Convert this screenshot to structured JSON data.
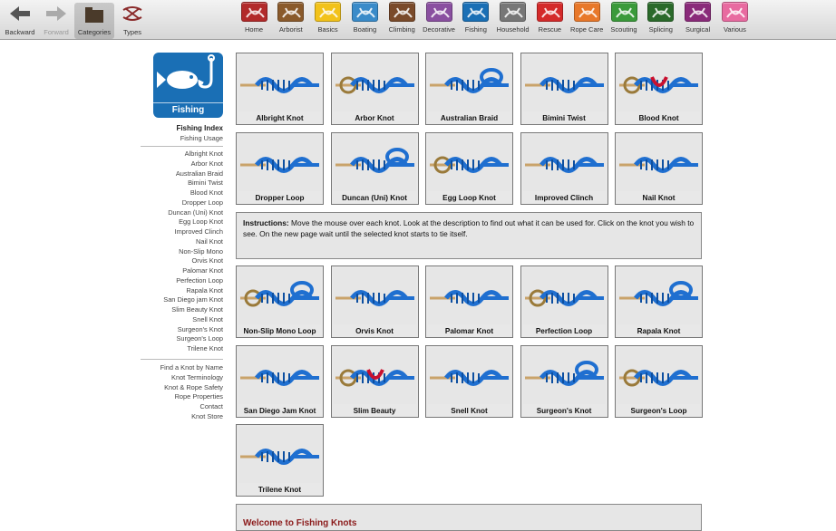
{
  "toolbar": {
    "nav": [
      {
        "label": "Backward",
        "icon": "back-arrow-icon",
        "enabled": true
      },
      {
        "label": "Forward",
        "icon": "forward-arrow-icon",
        "enabled": false
      },
      {
        "label": "Categories",
        "icon": "categories-icon",
        "active": true
      },
      {
        "label": "Types",
        "icon": "types-icon"
      }
    ],
    "categories": [
      {
        "label": "Home",
        "color": "#b22a2a",
        "icon": "knot-home-icon"
      },
      {
        "label": "Arborist",
        "color": "#8a5a2b",
        "icon": "tree-icon"
      },
      {
        "label": "Basics",
        "color": "#f2c21a",
        "icon": "cube-icon"
      },
      {
        "label": "Boating",
        "color": "#3a8bc9",
        "icon": "sailboat-icon"
      },
      {
        "label": "Climbing",
        "color": "#7a4a2a",
        "icon": "climber-icon"
      },
      {
        "label": "Decorative",
        "color": "#8a4fa0",
        "icon": "decorative-knot-icon"
      },
      {
        "label": "Fishing",
        "color": "#1a6fb5",
        "icon": "fish-icon"
      },
      {
        "label": "Household",
        "color": "#777777",
        "icon": "house-icon"
      },
      {
        "label": "Rescue",
        "color": "#d42a2a",
        "icon": "helicopter-icon"
      },
      {
        "label": "Rope Care",
        "color": "#e8782a",
        "icon": "rope-coil-icon"
      },
      {
        "label": "Scouting",
        "color": "#3a9a3a",
        "icon": "tent-icon"
      },
      {
        "label": "Splicing",
        "color": "#2a6a2a",
        "icon": "splice-icon"
      },
      {
        "label": "Surgical",
        "color": "#8a2a7a",
        "icon": "medical-bag-icon"
      },
      {
        "label": "Various",
        "color": "#e86aa0",
        "icon": "various-icon"
      }
    ]
  },
  "sidebar": {
    "logo_caption": "Fishing",
    "index_links": [
      "Fishing Index",
      "Fishing Usage"
    ],
    "knot_links": [
      "Albright Knot",
      "Arbor Knot",
      "Australian Braid",
      "Bimini Twist",
      "Blood Knot",
      "Dropper Loop",
      "Duncan (Uni) Knot",
      "Egg Loop Knot",
      "Improved Clinch",
      "Nail Knot",
      "Non-Slip Mono",
      "Orvis Knot",
      "Palomar Knot",
      "Perfection Loop",
      "Rapala Knot",
      "San Diego jam Knot",
      "Slim Beauty Knot",
      "Snell Knot",
      "Surgeon's Knot",
      "Surgeon's Loop",
      "Trilene Knot"
    ],
    "extra_links": [
      "Find a Knot by Name",
      "Knot Terminology",
      "Knot & Rope Safety",
      "Rope Properties",
      "Contact",
      "Knot Store"
    ]
  },
  "knots_top": [
    "Albright Knot",
    "Arbor Knot",
    "Australian Braid",
    "Bimini Twist",
    "Blood Knot",
    "Dropper Loop",
    "Duncan (Uni) Knot",
    "Egg Loop Knot",
    "Improved Clinch",
    "Nail Knot"
  ],
  "instructions": {
    "label": "Instructions:",
    "text": " Move the mouse over each knot. Look at the description to find out what it can be used for. Click on the knot you wish to see. On the new page wait until the selected knot starts to tie itself."
  },
  "knots_bottom": [
    "Non-Slip Mono Loop",
    "Orvis Knot",
    "Palomar Knot",
    "Perfection Loop",
    "Rapala Knot",
    "San Diego Jam Knot",
    "Slim Beauty",
    "Snell Knot",
    "Surgeon's Knot",
    "Surgeon's Loop",
    "Trilene Knot"
  ],
  "welcome": "Welcome to Fishing Knots",
  "colors": {
    "rope_blue": "#1f6fd0",
    "accent_red": "#c8102e",
    "tile_bg": "#e6e6e6"
  }
}
